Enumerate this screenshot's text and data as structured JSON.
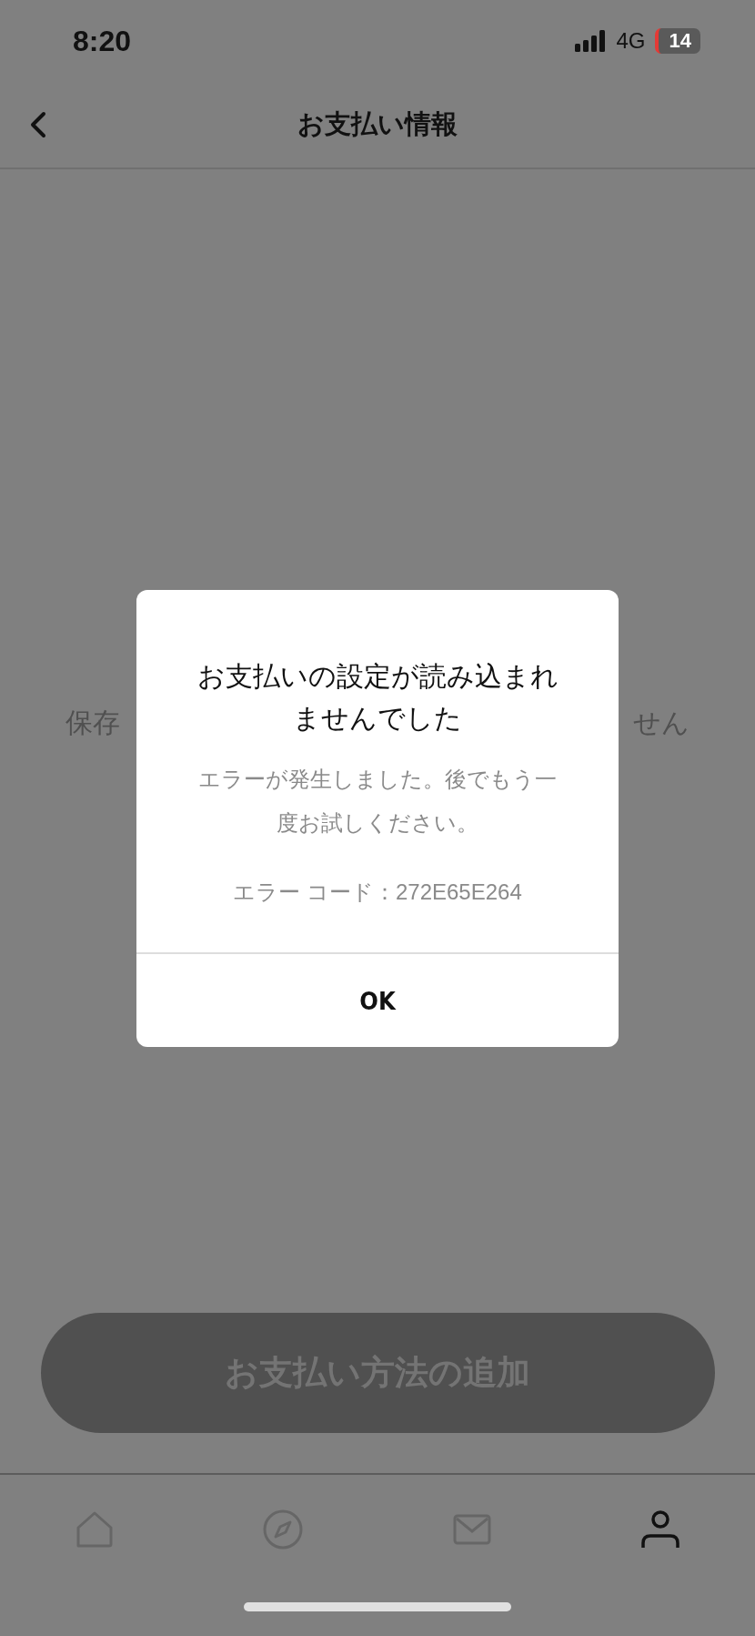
{
  "status_bar": {
    "time": "8:20",
    "network": "4G",
    "battery": "14"
  },
  "nav": {
    "title": "お支払い情報"
  },
  "empty_message": {
    "left_visible": "保存",
    "right_visible": "せん"
  },
  "add_button": {
    "label": "お支払い方法の追加",
    "disabled": true
  },
  "dialog": {
    "title": "お支払いの設定が読み込まれませんでした",
    "message": "エラーが発生しました。後でもう一度お試しください。",
    "error_code": "エラー コード：272E65E264",
    "button": "OK"
  },
  "tabs": [
    {
      "kind": "home",
      "selected": false
    },
    {
      "kind": "explore",
      "selected": false
    },
    {
      "kind": "inbox",
      "selected": false
    },
    {
      "kind": "profile",
      "selected": true
    }
  ]
}
